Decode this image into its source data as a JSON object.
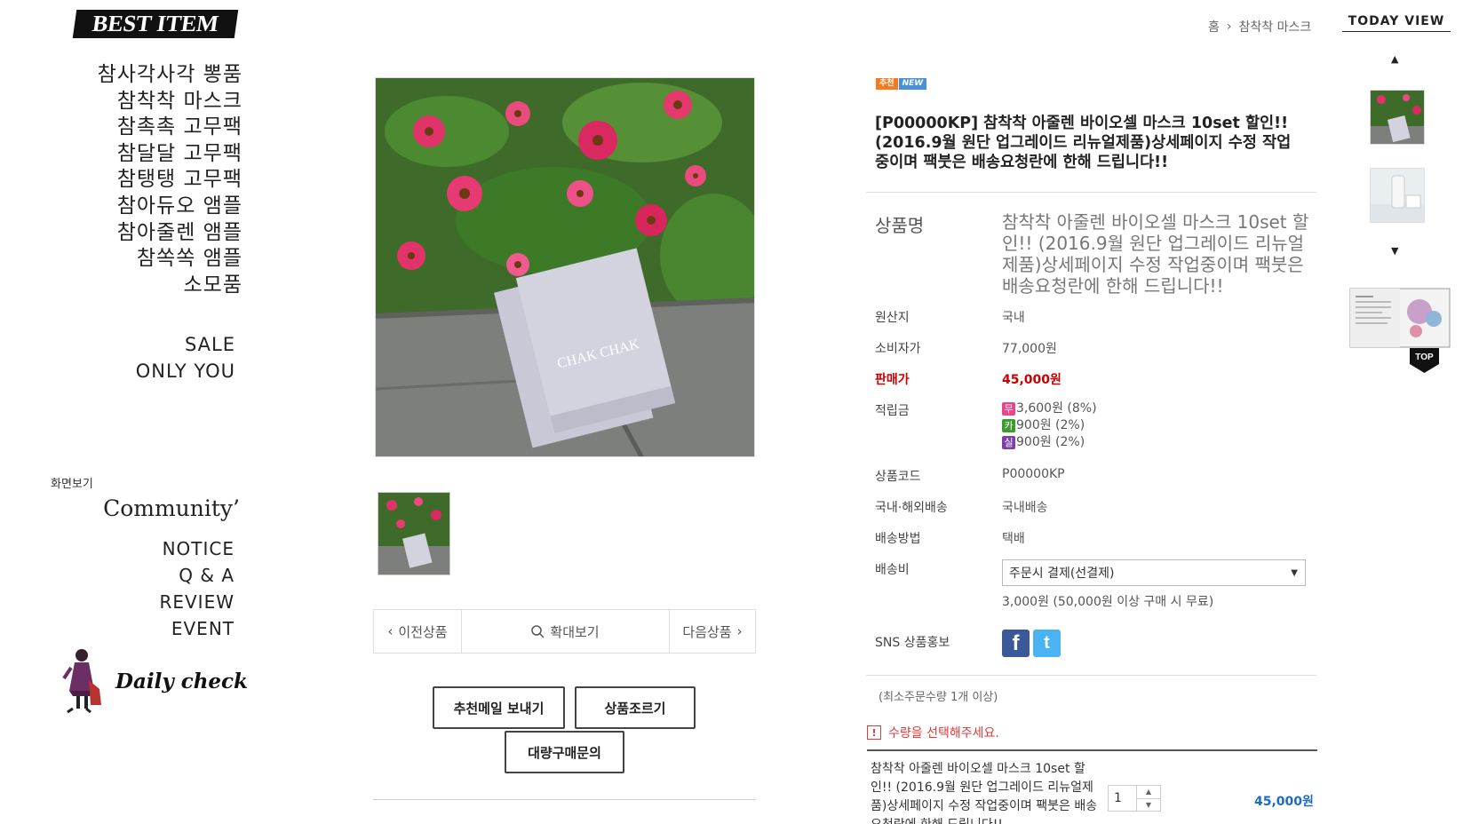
{
  "logo": "BEST ITEM",
  "categories": [
    "참사각사각 뽕품",
    "참착착 마스크",
    "참촉촉 고무팩",
    "참달달 고무팩",
    "참탱탱 고무팩",
    "참아듀오 앰플",
    "참아줄렌 앰플",
    "참쏙쏙 앰플",
    "소모품"
  ],
  "sale_links": [
    "SALE",
    "ONLY YOU"
  ],
  "view_label": "화면보기",
  "community_title": "Community’",
  "community_links": [
    "NOTICE",
    "Q & A",
    "REVIEW",
    "EVENT"
  ],
  "daily_check": "Daily check",
  "breadcrumb": {
    "home": "홈",
    "current": "참착착 마스크"
  },
  "today_view": {
    "title": "TODAY VIEW",
    "top_label": "TOP"
  },
  "product": {
    "badge_recommend": "추천",
    "badge_new": "NEW",
    "title": "[P00000KP] 참착착 아줄렌 바이오셀 마스크 10set 할인!! (2016.9월 원단 업그레이드 리뉴얼제품)상세페이지 수정 작업중이며 팩붓은 배송요청란에 한해 드립니다!!",
    "image_text": "CHAK CHAK"
  },
  "info": {
    "name_label": "상품명",
    "name_value": "참착착 아줄렌 바이오셀 마스크 10set 할인!! (2016.9월 원단 업그레이드 리뉴얼제품)상세페이지 수정 작업중이며 팩붓은 배송요청란에 한해 드립니다!!",
    "origin_label": "원산지",
    "origin_value": "국내",
    "consumer_label": "소비자가",
    "consumer_value": "77,000원",
    "sale_label": "판매가",
    "sale_value": "45,000원",
    "points_label": "적립금",
    "points": [
      {
        "icon": "무",
        "color": "#e8458b",
        "text": "3,600원 (8%)"
      },
      {
        "icon": "카",
        "color": "#3c9a2e",
        "text": "900원 (2%)"
      },
      {
        "icon": "실",
        "color": "#7b3fa8",
        "text": "900원 (2%)"
      }
    ],
    "code_label": "상품코드",
    "code_value": "P00000KP",
    "delivery_type_label": "국내·해외배송",
    "delivery_type_value": "국내배송",
    "delivery_method_label": "배송방법",
    "delivery_method_value": "택배",
    "delivery_fee_label": "배송비",
    "delivery_fee_select": "주문시 결제(선결제)",
    "delivery_fee_note": "3,000원 (50,000원 이상 구매 시 무료)",
    "sns_label": "SNS 상품홍보"
  },
  "min_order": "(최소주문수량 1개 이상)",
  "warning": "수량을 선택해주세요.",
  "order": {
    "name": "참착착 아줄렌 바이오셀 마스크 10set 할인!! (2016.9월 원단 업그레이드 리뉴얼제품)상세페이지 수정 작업중이며 팩붓은 배송요청란에 한해 드립니다!!",
    "quantity": "1",
    "price": "45,000원"
  },
  "nav": {
    "prev": "이전상품",
    "zoom": "확대보기",
    "next": "다음상품"
  },
  "buttons": {
    "mail": "추천메일 보내기",
    "ask": "상품조르기",
    "bulk": "대량구매문의"
  }
}
